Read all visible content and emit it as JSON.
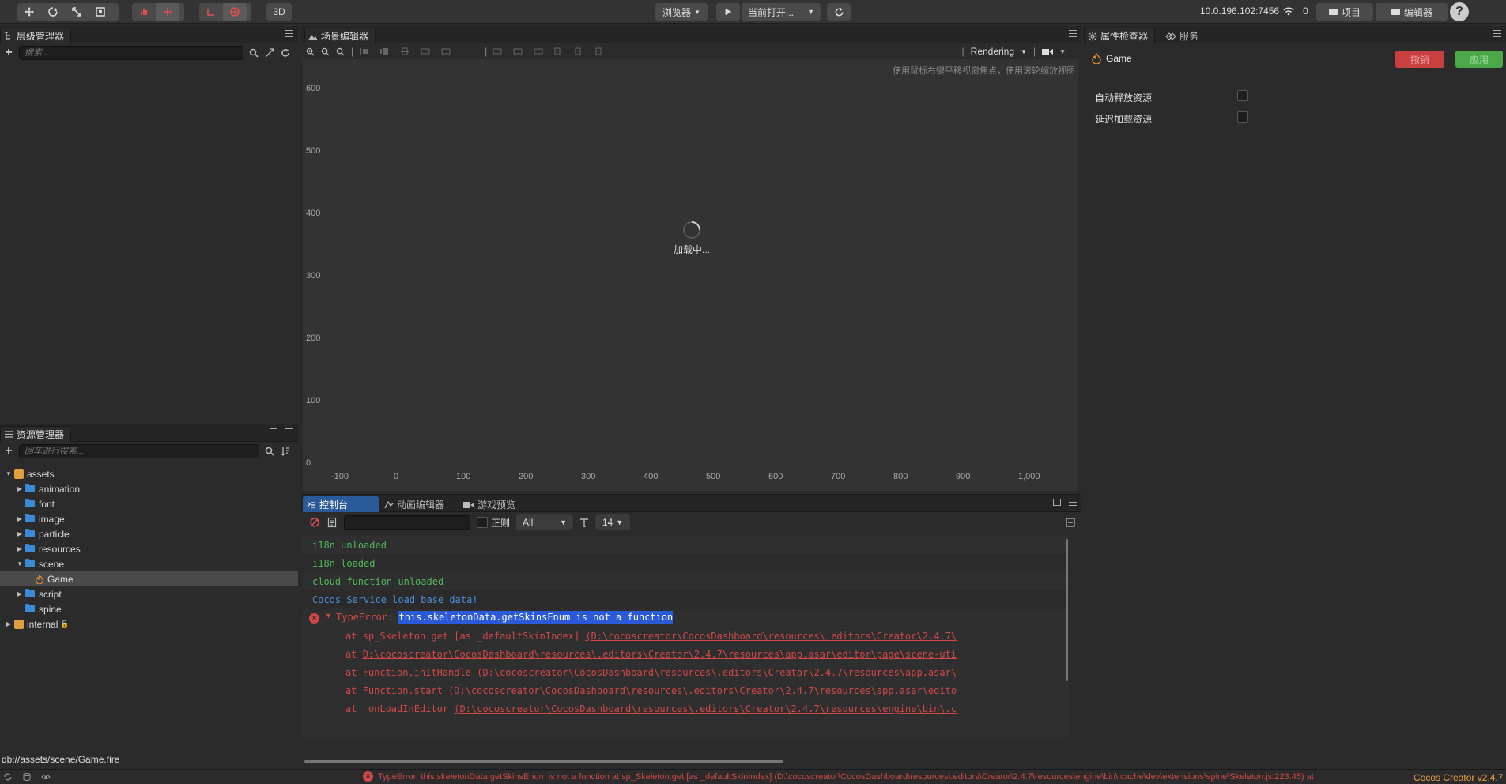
{
  "toolbar": {
    "mode_3d": "3D",
    "browser": "浏览器",
    "current_open": "当前打开...",
    "ip": "10.0.196.102:7456",
    "connections": "0",
    "project": "项目",
    "editor": "编辑器",
    "help": "?"
  },
  "hierarchy": {
    "title": "层级管理器",
    "search_placeholder": "搜索..."
  },
  "assets": {
    "title": "资源管理器",
    "search_placeholder": "回车进行搜索...",
    "items": [
      {
        "label": "assets",
        "level": 0,
        "expanded": true,
        "type": "db"
      },
      {
        "label": "animation",
        "level": 1,
        "expanded": false,
        "type": "folder"
      },
      {
        "label": "font",
        "level": 1,
        "expanded": null,
        "type": "folder"
      },
      {
        "label": "image",
        "level": 1,
        "expanded": false,
        "type": "folder"
      },
      {
        "label": "particle",
        "level": 1,
        "expanded": false,
        "type": "folder"
      },
      {
        "label": "resources",
        "level": 1,
        "expanded": false,
        "type": "folder"
      },
      {
        "label": "scene",
        "level": 1,
        "expanded": true,
        "type": "folder"
      },
      {
        "label": "Game",
        "level": 2,
        "expanded": null,
        "type": "fire",
        "selected": true
      },
      {
        "label": "script",
        "level": 1,
        "expanded": false,
        "type": "folder"
      },
      {
        "label": "spine",
        "level": 1,
        "expanded": null,
        "type": "folder"
      },
      {
        "label": "internal",
        "level": 0,
        "expanded": false,
        "type": "db-locked"
      }
    ],
    "path": "db://assets/scene/Game.fire"
  },
  "scene": {
    "title": "场景编辑器",
    "rendering": "Rendering",
    "hint": "使用鼠标右键平移视窗焦点，使用滚轮缩放视图",
    "loading": "加载中...",
    "y_ticks": [
      "600",
      "500",
      "400",
      "300",
      "200",
      "100",
      "0"
    ],
    "x_ticks": [
      "-100",
      "0",
      "100",
      "200",
      "300",
      "400",
      "500",
      "600",
      "700",
      "800",
      "900",
      "1,000"
    ]
  },
  "console": {
    "tabs": [
      "控制台",
      "动画编辑器",
      "游戏预览"
    ],
    "regex_label": "正则",
    "level_select": "All",
    "font_size": "14",
    "logs": [
      {
        "text": "i18n unloaded",
        "color": "#4fb85a"
      },
      {
        "text": "i18n loaded",
        "color": "#4fb85a"
      },
      {
        "text": "cloud-function unloaded",
        "color": "#4fb85a"
      },
      {
        "text": "Cocos Service load base data!",
        "color": "#4a8fd6"
      }
    ],
    "error": {
      "prefix": "TypeError: ",
      "message": "this.skeletonData.getSkinsEnum is not a function",
      "stack": [
        {
          "at": "at sp_Skeleton.get [as _defaultSkinIndex]",
          "path": "(D:\\cocoscreator\\CocosDashboard\\resources\\.editors\\Creator\\2.4.7\\"
        },
        {
          "at": "at ",
          "path": "D:\\cocoscreator\\CocosDashboard\\resources\\.editors\\Creator\\2.4.7\\resources\\app.asar\\editor\\page\\scene-uti"
        },
        {
          "at": "at Function.initHandle",
          "path": "(D:\\cocoscreator\\CocosDashboard\\resources\\.editors\\Creator\\2.4.7\\resources\\app.asar\\"
        },
        {
          "at": "at Function.start",
          "path": "(D:\\cocoscreator\\CocosDashboard\\resources\\.editors\\Creator\\2.4.7\\resources\\app.asar\\edito"
        },
        {
          "at": "at _onLoadInEditor",
          "path": "(D:\\cocoscreator\\CocosDashboard\\resources\\.editors\\Creator\\2.4.7\\resources\\engine\\bin\\.c"
        }
      ]
    }
  },
  "inspector": {
    "tabs": [
      "属性检查器",
      "服务"
    ],
    "node_name": "Game",
    "revert": "撤销",
    "apply": "应用",
    "props": [
      {
        "label": "自动释放资源"
      },
      {
        "label": "延迟加载资源"
      }
    ]
  },
  "status": {
    "error_text": "TypeError: this.skeletonData.getSkinsEnum is not a function at sp_Skeleton.get [as _defaultSkinIndex] (D:\\cocoscreator\\CocosDashboard\\resources\\.editors\\Creator\\2.4.7\\resources\\engine\\bin\\.cache\\dev\\extensions\\spine\\Skeleton.js:223:45) at",
    "version": "Cocos Creator v2.4.7"
  },
  "colors": {
    "accent_blue": "#2a5a9a",
    "error_red": "#d04848",
    "revert_red": "#c84040",
    "apply_green": "#4aa84a",
    "version_orange": "#e8a040"
  }
}
